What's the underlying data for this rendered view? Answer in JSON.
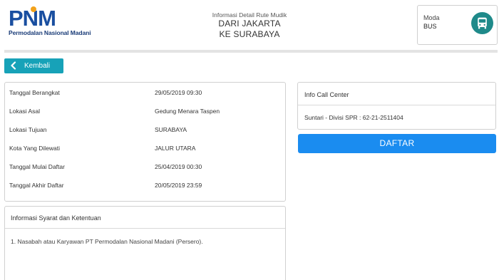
{
  "brand": {
    "logo_text": "PNM",
    "tagline": "Permodalan Nasional Madani"
  },
  "route": {
    "caption": "Informasi Detail Rute Mudik",
    "from": "DARI JAKARTA",
    "to": "KE SURABAYA"
  },
  "moda": {
    "label": "Moda",
    "value": "BUS",
    "icon": "bus-icon",
    "icon_color": "#1f8a8a"
  },
  "back_button": {
    "label": "Kembali",
    "icon": "chevron-left-icon",
    "color": "#17a2b8"
  },
  "details": [
    {
      "label": "Tanggal Berangkat",
      "value": "29/05/2019 09:30"
    },
    {
      "label": "Lokasi Asal",
      "value": "Gedung Menara Taspen"
    },
    {
      "label": "Lokasi Tujuan",
      "value": "SURABAYA"
    },
    {
      "label": "Kota Yang Dilewati",
      "value": "JALUR UTARA"
    },
    {
      "label": "Tanggal Mulai Daftar",
      "value": "25/04/2019 00:30"
    },
    {
      "label": "Tanggal Akhir Daftar",
      "value": "20/05/2019 23:59"
    }
  ],
  "terms": {
    "title": "Informasi Syarat dan Ketentuan",
    "items": [
      "1. Nasabah atau Karyawan PT Permodalan Nasional Madani (Persero)."
    ]
  },
  "call_center": {
    "title": "Info Call Center",
    "value": "Suntari - Divisi SPR : 62-21-2511404"
  },
  "register_button": {
    "label": "DAFTAR",
    "color": "#1a8cf0"
  }
}
